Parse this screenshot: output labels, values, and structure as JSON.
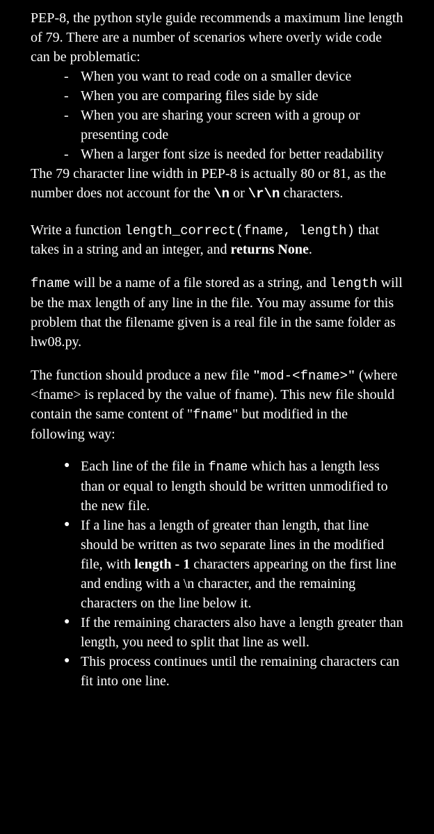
{
  "intro": "PEP-8, the python style guide recommends a maximum line length of 79. There are a number of scenarios where overly wide code can be problematic:",
  "scenarios": [
    "When you want to read code on a smaller device",
    "When you are comparing files side by side",
    "When you are sharing your screen with a group or presenting code",
    "When a larger font size is needed for better readability"
  ],
  "after_scenarios_1": "The 79 character line width in PEP-8 is actually 80 or 81, as the number does not account for the ",
  "code_n": "\\n",
  "after_scenarios_2": " or ",
  "code_rn": "\\r\\n",
  "after_scenarios_3": " characters.",
  "write_1": "Write a function ",
  "code_func": "length_correct(fname, length)",
  "write_2": " that takes in a string and an integer, and ",
  "write_bold": "returns None",
  "write_3": ".",
  "fname_1a": "fname",
  "fname_1b": " will be a name of a file stored as a string, and ",
  "fname_2a": "length",
  "fname_2b": " will be the max length of any line in the file. You may assume for this problem that the filename given is a real file in the same folder as hw08.py.",
  "produce_1": "The function should produce a new file ",
  "produce_1b": "\"",
  "produce_code_mod": "mod-<fname>",
  "produce_1c": "\"",
  "produce_2": " (where <fname> is replaced by the value of fname). This new file should contain the same content of \"",
  "produce_code_fname": "fname",
  "produce_3": "\" but modified in the following way:",
  "rules": [
    {
      "pre": "Each line of the file in ",
      "code": "fname",
      "post": " which has a length less than or equal to length should be written unmodified to the new file."
    },
    {
      "pre": "If a line has a length of greater than length, that line should be written as two separate lines in the modified file, with ",
      "bold": "length - 1",
      "post": " characters appearing on the first line and ending with a \\n character, and the remaining characters on the line below it."
    },
    {
      "text": "If the remaining characters also have a length greater than length, you need to split that line as well."
    },
    {
      "text": "This process continues until the remaining characters can fit into one line."
    }
  ]
}
